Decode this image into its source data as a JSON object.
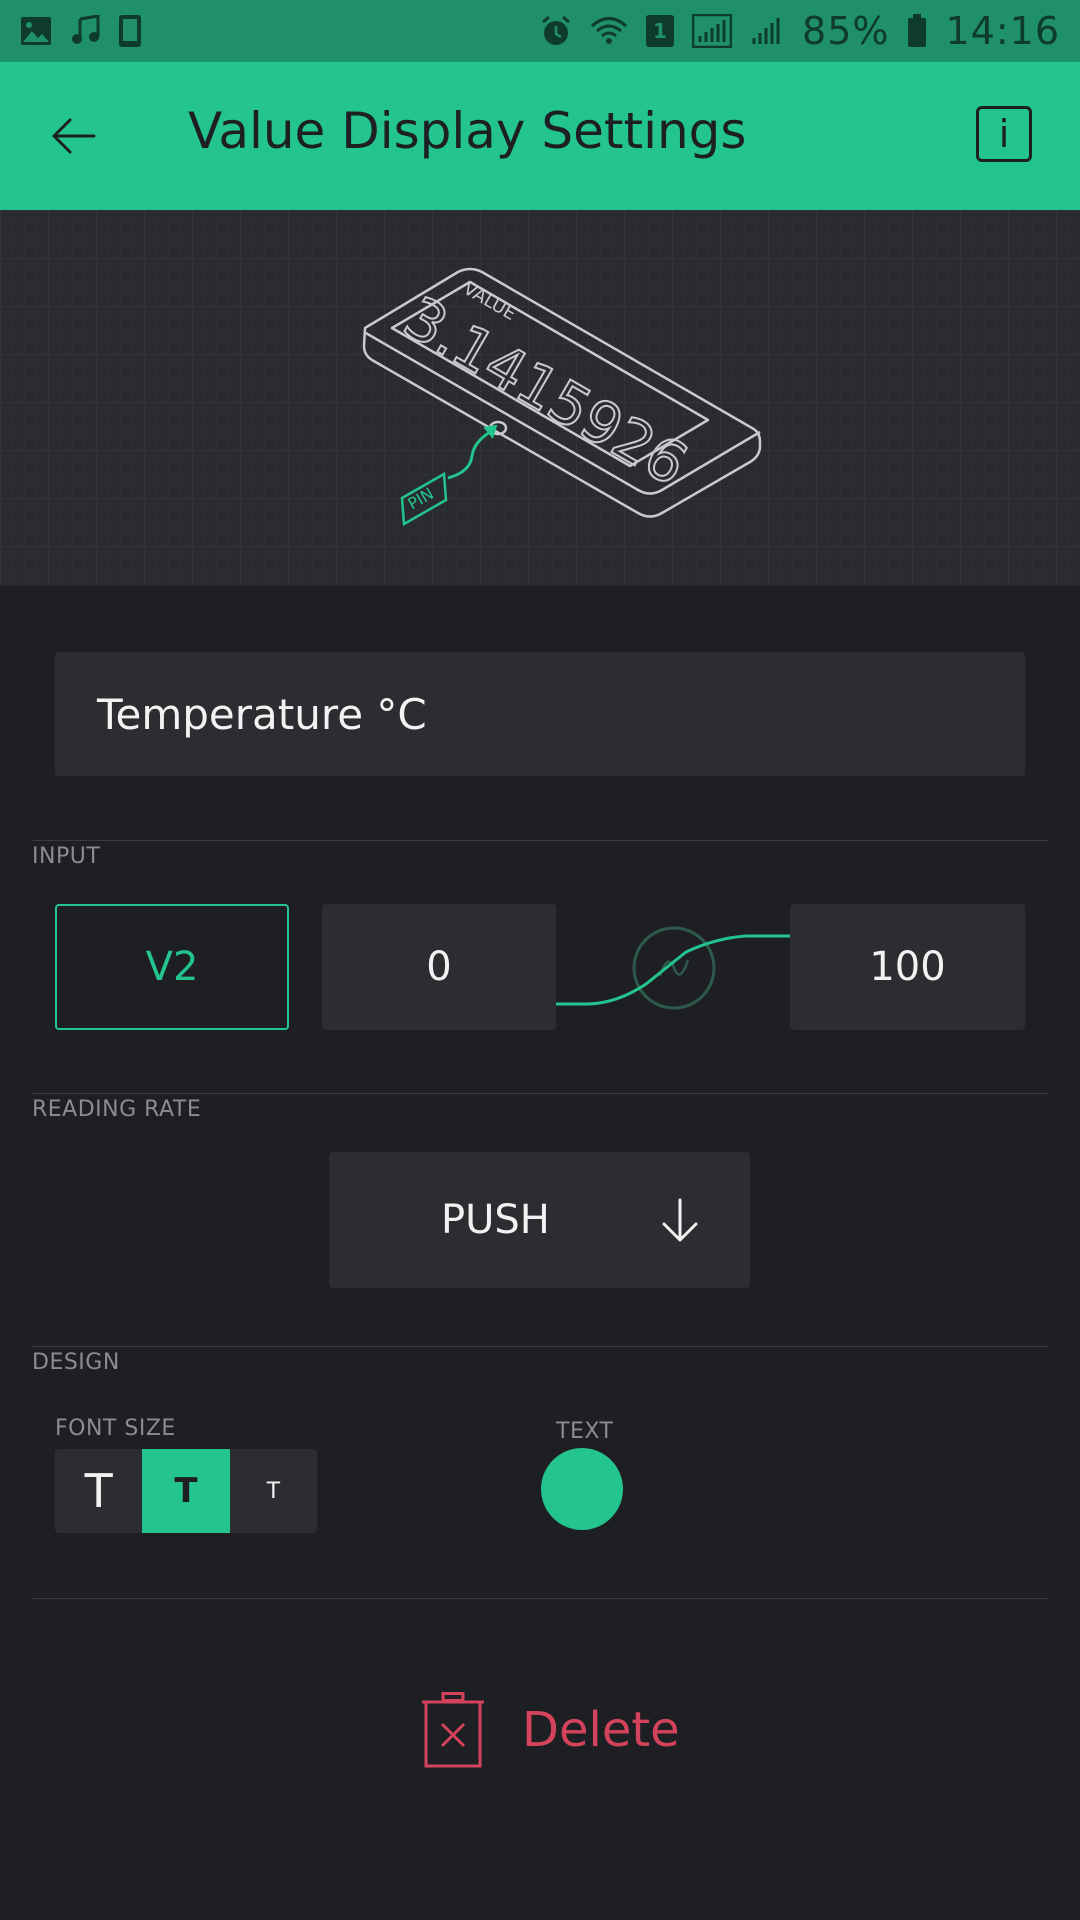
{
  "status_bar": {
    "battery_percent": "85%",
    "time": "14:16",
    "sim_badge": "1",
    "icons": [
      "image-icon",
      "music-icon",
      "phone-icon",
      "alarm-icon",
      "wifi-icon",
      "sim-icon",
      "signal-icon",
      "signal-icon-2",
      "battery-icon"
    ]
  },
  "app_bar": {
    "title": "Value Display Settings",
    "back_icon": "arrow-left-icon",
    "info_label": "i"
  },
  "preview": {
    "widget_label": "VALUE",
    "widget_value": "3.1415926",
    "pin_label": "PIN"
  },
  "name_field": {
    "value": "Temperature °C"
  },
  "input": {
    "section_label": "INPUT",
    "pin": "V2",
    "min": "0",
    "max": "100"
  },
  "reading_rate": {
    "section_label": "READING RATE",
    "value": "PUSH"
  },
  "design": {
    "section_label": "DESIGN",
    "font_size_label": "FONT SIZE",
    "font_sizes": [
      "T",
      "T",
      "T"
    ],
    "font_size_selected_index": 1,
    "text_color_label": "TEXT",
    "text_color": "#23c48e"
  },
  "delete": {
    "label": "Delete"
  },
  "colors": {
    "accent": "#23c48e",
    "status_bar": "#1f8f6c",
    "background": "#1e1f23",
    "field": "#2c2d31",
    "danger": "#d3435c"
  }
}
